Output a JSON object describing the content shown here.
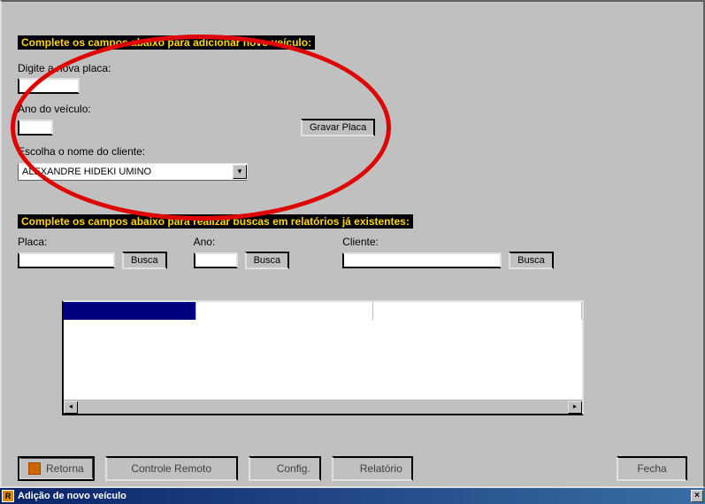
{
  "window": {
    "title": "Adição de novo veículo",
    "icon_letter": "R",
    "close_glyph": "×"
  },
  "section_add": {
    "header": "Complete os campos abaixo para adicionar novo veículo:",
    "placa_label": "Digite a nova placa:",
    "placa_value": "",
    "ano_label": "Ano do veículo:",
    "ano_value": "",
    "cliente_label": "Escolha o nome do cliente:",
    "cliente_value": "ALEXANDRE HIDEKI UMINO",
    "gravar_button": "Gravar Placa"
  },
  "section_search": {
    "header": "Complete os campos abaixo para realizar buscas em relatórios já existentes:",
    "placa_label": "Placa:",
    "ano_label": "Ano:",
    "cliente_label": "Cliente:",
    "busca_button": "Busca"
  },
  "toolbar": {
    "retorna": "Retorna",
    "controle": "Controle Remoto",
    "config": "Config.",
    "relatorio": "Relatório",
    "fecha": "Fecha"
  },
  "scroll": {
    "left": "◄",
    "right": "►"
  }
}
